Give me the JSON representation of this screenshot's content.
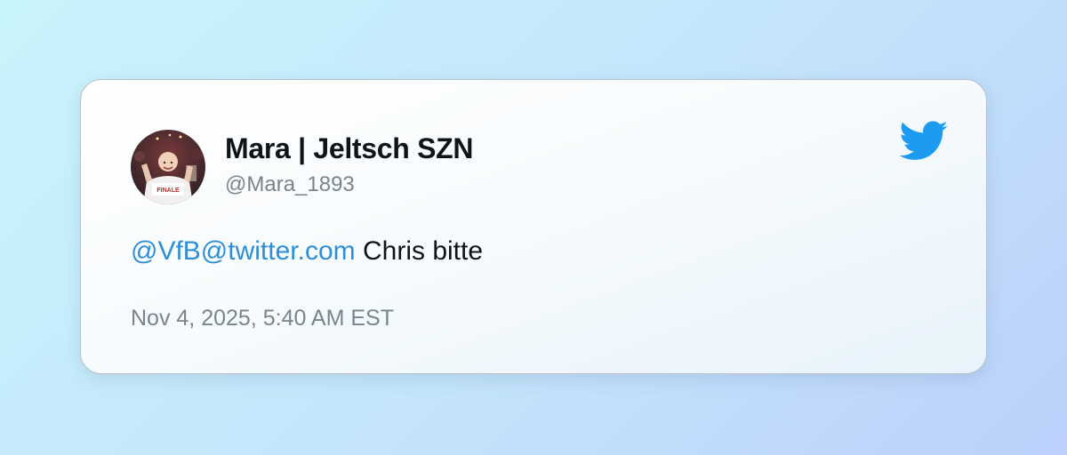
{
  "user": {
    "display_name": "Mara | Jeltsch SZN",
    "handle": "@Mara_1893",
    "avatar_icon": "profile-photo",
    "avatar_shirt_text": "FINALE"
  },
  "tweet": {
    "mention": "@VfB@twitter.com",
    "text": " Chris bitte",
    "timestamp": "Nov 4, 2025, 5:40 AM EST"
  },
  "brand": {
    "icon": "twitter-bird-icon",
    "color": "#1d9bf0",
    "link_color": "#2f8fd6"
  }
}
